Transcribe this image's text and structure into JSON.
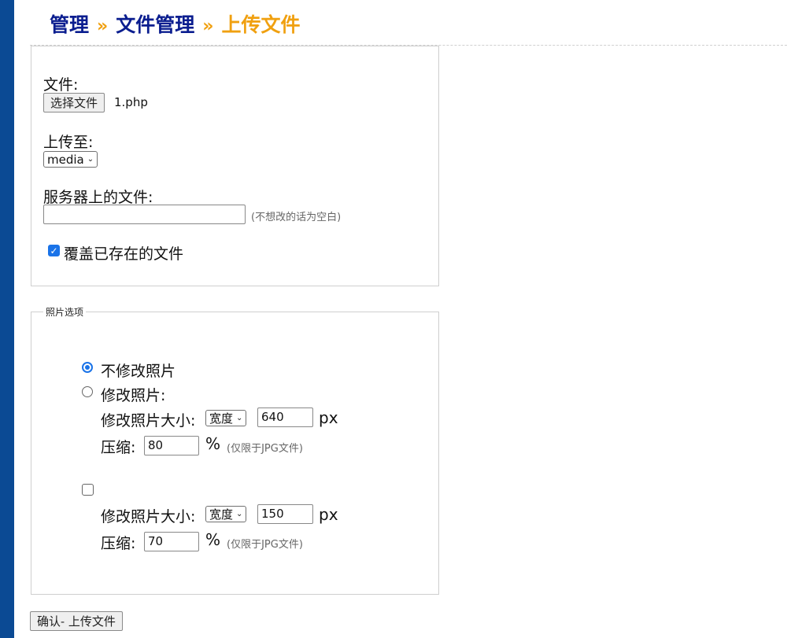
{
  "breadcrumb": {
    "items": [
      "管理",
      "文件管理"
    ],
    "separator": "»",
    "current": "上传文件"
  },
  "upload_form": {
    "file_label": "文件:",
    "choose_file_button": "选择文件",
    "selected_file": "1.php",
    "upload_to_label": "上传至:",
    "upload_to_value": "media",
    "server_file_label": "服务器上的文件:",
    "server_file_value": "",
    "server_file_hint": "(不想改的话为空白)",
    "overwrite_label": "覆盖已存在的文件",
    "overwrite_checked": true
  },
  "photo_options": {
    "legend": "照片选项",
    "no_modify_label": "不修改照片",
    "no_modify_checked": true,
    "modify_label": "修改照片:",
    "modify_checked": false,
    "resize_label": "修改照片大小:",
    "resize_dimension": "宽度",
    "resize_value": "640",
    "px_unit": "px",
    "compress_label": "压缩:",
    "compress_value": "80",
    "percent_unit": "%",
    "jpg_hint": "(仅限于JPG文件)",
    "thumb_checked": false,
    "thumb_resize_label": "修改照片大小:",
    "thumb_resize_dimension": "宽度",
    "thumb_resize_value": "150",
    "thumb_px_unit": "px",
    "thumb_compress_label": "压缩:",
    "thumb_compress_value": "70",
    "thumb_percent_unit": "%",
    "thumb_jpg_hint": "(仅限于JPG文件)"
  },
  "submit_button": "确认- 上传文件",
  "colors": {
    "sidebar": "#0b4a94",
    "breadcrumb_link": "#0a1d8f",
    "breadcrumb_current": "#f0a010",
    "accent": "#1a73e8"
  }
}
